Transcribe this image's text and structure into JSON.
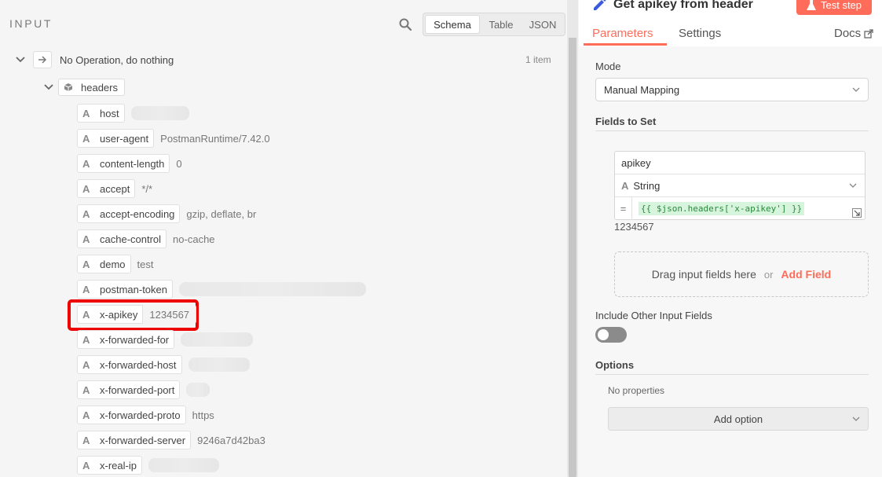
{
  "input_panel": {
    "title": "INPUT",
    "views": [
      "Schema",
      "Table",
      "JSON"
    ],
    "active_view": "Schema",
    "root_node": {
      "label": "No Operation, do nothing",
      "count": "1 item"
    },
    "object_node": {
      "label": "headers"
    },
    "fields": [
      {
        "name": "host",
        "value": ""
      },
      {
        "name": "user-agent",
        "value": "PostmanRuntime/7.42.0"
      },
      {
        "name": "content-length",
        "value": "0"
      },
      {
        "name": "accept",
        "value": "*/*"
      },
      {
        "name": "accept-encoding",
        "value": "gzip, deflate, br"
      },
      {
        "name": "cache-control",
        "value": "no-cache"
      },
      {
        "name": "demo",
        "value": "test"
      },
      {
        "name": "postman-token",
        "value": ""
      },
      {
        "name": "x-apikey",
        "value": "1234567"
      },
      {
        "name": "x-forwarded-for",
        "value": ""
      },
      {
        "name": "x-forwarded-host",
        "value": ""
      },
      {
        "name": "x-forwarded-port",
        "value": ""
      },
      {
        "name": "x-forwarded-proto",
        "value": "https"
      },
      {
        "name": "x-forwarded-server",
        "value": "9246a7d42ba3"
      },
      {
        "name": "x-real-ip",
        "value": ""
      }
    ],
    "type_glyph": "A"
  },
  "node_panel": {
    "title": "Get apikey from header",
    "test_button": "Test step",
    "tabs": {
      "parameters": "Parameters",
      "settings": "Settings",
      "docs": "Docs"
    },
    "mode_label": "Mode",
    "mode_value": "Manual Mapping",
    "fields_to_set_label": "Fields to Set",
    "assignment": {
      "name": "apikey",
      "type_glyph": "A",
      "type": "String",
      "eq": "=",
      "expression": "{{ $json.headers['x-apikey'] }}",
      "result": "1234567"
    },
    "drop_text": "Drag input fields here",
    "drop_or": "or",
    "add_field": "Add Field",
    "include_other_label": "Include Other Input Fields",
    "include_other_enabled": false,
    "options_label": "Options",
    "no_properties": "No properties",
    "add_option": "Add option"
  },
  "colors": {
    "accent": "#ff6d5a",
    "highlight": "#ee0000",
    "expr_green": "#2b8a3e"
  }
}
